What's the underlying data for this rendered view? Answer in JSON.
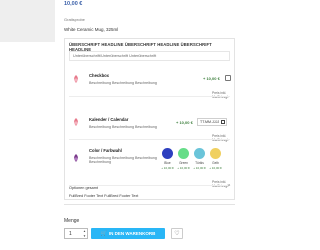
{
  "product": {
    "price": "10,00 €",
    "gratis_label": "Gratisprobe",
    "name": "White Ceramic Mug, 325ml"
  },
  "card": {
    "headline": "ÜBERSCHRIFT HEADLINE ÜBERSCHRIFT HEADLINE ÜBERSCHRIFT HEADLINE",
    "subheadline": "Unterüberschrift/Unterüberschrift Unterüberschrift"
  },
  "options": {
    "checkbox": {
      "title": "Checkbox",
      "description": "Beschreibung Beschreibung Beschreibung",
      "price": "+ 10,00 €"
    },
    "calendar": {
      "title": "Kalender / Calendar",
      "description": "Beschreibung Beschreibung Beschreibung",
      "price": "+ 10,00 €",
      "date_value": "TT.MM.JJJJ",
      "note": "Preis inkl. MwSt./zzgl."
    },
    "checkbox_note": "Preis inkl. MwSt./zzgl.",
    "color": {
      "title": "Color / Farbwahl",
      "description": "Beschreibung Beschreibung Beschreibung Beschreibung",
      "swatches": [
        {
          "label": "Blue",
          "price": "+ 10,00 €",
          "color": "#2d3fbf"
        },
        {
          "label": "Green",
          "price": "+ 10,00 €",
          "color": "#66dd88"
        },
        {
          "label": "Türkis",
          "price": "+ 10,00 €",
          "color": "#6ac4d9"
        },
        {
          "label": "Gelb",
          "price": "+ 10,00 €",
          "color": "#f0d060"
        }
      ],
      "note": "Preis inkl. MwSt./zzgl."
    }
  },
  "group": {
    "title": "Optionen gesamt"
  },
  "footer_text": "FullBred Footer Text FullBred Footer Text",
  "buy": {
    "qty_label": "Menge",
    "qty_value": "1",
    "cart_button": "IN DEN WARENKORB"
  },
  "colors": {
    "accent": "#29b6f6",
    "price": "#3a5fa8",
    "option_price": "#3a7d3a"
  }
}
